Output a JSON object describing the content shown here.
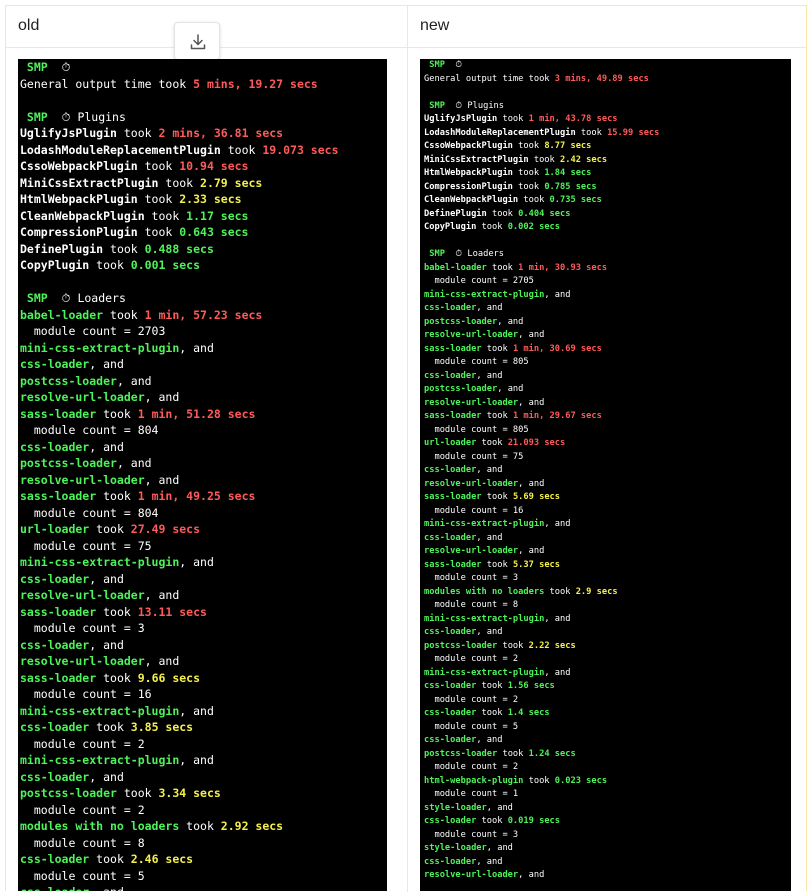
{
  "columns": {
    "old": "old",
    "new": "new"
  },
  "colors": {
    "green": "#4ef25a",
    "red": "#ff5a5a",
    "yellow": "#f5f04a",
    "white": "#ffffff",
    "background": "#000000"
  },
  "icons": {
    "download": "download-icon",
    "stopwatch": "stopwatch-icon"
  },
  "old_log": [
    [
      {
        "t": " SMP  ",
        "c": "smp"
      },
      {
        "t": "⏱",
        "c": "white"
      }
    ],
    [
      {
        "t": "General output time took ",
        "c": "white"
      },
      {
        "t": "5 mins, 19.27 secs",
        "c": "red"
      }
    ],
    [],
    [
      {
        "t": " SMP  ",
        "c": "smp"
      },
      {
        "t": "⏱ Plugins",
        "c": "white"
      }
    ],
    [
      {
        "t": "UglifyJsPlugin",
        "c": "name"
      },
      {
        "t": " took ",
        "c": "white"
      },
      {
        "t": "2 mins, 36.81 secs",
        "c": "red"
      }
    ],
    [
      {
        "t": "LodashModuleReplacementPlugin",
        "c": "name"
      },
      {
        "t": " took ",
        "c": "white"
      },
      {
        "t": "19.073 secs",
        "c": "red"
      }
    ],
    [
      {
        "t": "CssoWebpackPlugin",
        "c": "name"
      },
      {
        "t": " took ",
        "c": "white"
      },
      {
        "t": "10.94 secs",
        "c": "red"
      }
    ],
    [
      {
        "t": "MiniCssExtractPlugin",
        "c": "name"
      },
      {
        "t": " took ",
        "c": "white"
      },
      {
        "t": "2.79 secs",
        "c": "yellow"
      }
    ],
    [
      {
        "t": "HtmlWebpackPlugin",
        "c": "name"
      },
      {
        "t": " took ",
        "c": "white"
      },
      {
        "t": "2.33 secs",
        "c": "yellow"
      }
    ],
    [
      {
        "t": "CleanWebpackPlugin",
        "c": "name"
      },
      {
        "t": " took ",
        "c": "white"
      },
      {
        "t": "1.17 secs",
        "c": "green"
      }
    ],
    [
      {
        "t": "CompressionPlugin",
        "c": "name"
      },
      {
        "t": " took ",
        "c": "white"
      },
      {
        "t": "0.643 secs",
        "c": "green"
      }
    ],
    [
      {
        "t": "DefinePlugin",
        "c": "name"
      },
      {
        "t": " took ",
        "c": "white"
      },
      {
        "t": "0.488 secs",
        "c": "green"
      }
    ],
    [
      {
        "t": "CopyPlugin",
        "c": "name"
      },
      {
        "t": " took ",
        "c": "white"
      },
      {
        "t": "0.001 secs",
        "c": "green"
      }
    ],
    [],
    [
      {
        "t": " SMP  ",
        "c": "smp"
      },
      {
        "t": "⏱ Loaders",
        "c": "white"
      }
    ],
    [
      {
        "t": "babel-loader",
        "c": "green"
      },
      {
        "t": " took ",
        "c": "white"
      },
      {
        "t": "1 min, 57.23 secs",
        "c": "red"
      }
    ],
    [
      {
        "t": "  module count = 2703",
        "c": "white"
      }
    ],
    [
      {
        "t": "mini-css-extract-plugin",
        "c": "green"
      },
      {
        "t": ", and",
        "c": "white"
      }
    ],
    [
      {
        "t": "css-loader",
        "c": "green"
      },
      {
        "t": ", and",
        "c": "white"
      }
    ],
    [
      {
        "t": "postcss-loader",
        "c": "green"
      },
      {
        "t": ", and",
        "c": "white"
      }
    ],
    [
      {
        "t": "resolve-url-loader",
        "c": "green"
      },
      {
        "t": ", and",
        "c": "white"
      }
    ],
    [
      {
        "t": "sass-loader",
        "c": "green"
      },
      {
        "t": " took ",
        "c": "white"
      },
      {
        "t": "1 min, 51.28 secs",
        "c": "red"
      }
    ],
    [
      {
        "t": "  module count = 804",
        "c": "white"
      }
    ],
    [
      {
        "t": "css-loader",
        "c": "green"
      },
      {
        "t": ", and",
        "c": "white"
      }
    ],
    [
      {
        "t": "postcss-loader",
        "c": "green"
      },
      {
        "t": ", and",
        "c": "white"
      }
    ],
    [
      {
        "t": "resolve-url-loader",
        "c": "green"
      },
      {
        "t": ", and",
        "c": "white"
      }
    ],
    [
      {
        "t": "sass-loader",
        "c": "green"
      },
      {
        "t": " took ",
        "c": "white"
      },
      {
        "t": "1 min, 49.25 secs",
        "c": "red"
      }
    ],
    [
      {
        "t": "  module count = 804",
        "c": "white"
      }
    ],
    [
      {
        "t": "url-loader",
        "c": "green"
      },
      {
        "t": " took ",
        "c": "white"
      },
      {
        "t": "27.49 secs",
        "c": "red"
      }
    ],
    [
      {
        "t": "  module count = 75",
        "c": "white"
      }
    ],
    [
      {
        "t": "mini-css-extract-plugin",
        "c": "green"
      },
      {
        "t": ", and",
        "c": "white"
      }
    ],
    [
      {
        "t": "css-loader",
        "c": "green"
      },
      {
        "t": ", and",
        "c": "white"
      }
    ],
    [
      {
        "t": "resolve-url-loader",
        "c": "green"
      },
      {
        "t": ", and",
        "c": "white"
      }
    ],
    [
      {
        "t": "sass-loader",
        "c": "green"
      },
      {
        "t": " took ",
        "c": "white"
      },
      {
        "t": "13.11 secs",
        "c": "red"
      }
    ],
    [
      {
        "t": "  module count = 3",
        "c": "white"
      }
    ],
    [
      {
        "t": "css-loader",
        "c": "green"
      },
      {
        "t": ", and",
        "c": "white"
      }
    ],
    [
      {
        "t": "resolve-url-loader",
        "c": "green"
      },
      {
        "t": ", and",
        "c": "white"
      }
    ],
    [
      {
        "t": "sass-loader",
        "c": "green"
      },
      {
        "t": " took ",
        "c": "white"
      },
      {
        "t": "9.66 secs",
        "c": "yellow"
      }
    ],
    [
      {
        "t": "  module count = 16",
        "c": "white"
      }
    ],
    [
      {
        "t": "mini-css-extract-plugin",
        "c": "green"
      },
      {
        "t": ", and",
        "c": "white"
      }
    ],
    [
      {
        "t": "css-loader",
        "c": "green"
      },
      {
        "t": " took ",
        "c": "white"
      },
      {
        "t": "3.85 secs",
        "c": "yellow"
      }
    ],
    [
      {
        "t": "  module count = 2",
        "c": "white"
      }
    ],
    [
      {
        "t": "mini-css-extract-plugin",
        "c": "green"
      },
      {
        "t": ", and",
        "c": "white"
      }
    ],
    [
      {
        "t": "css-loader",
        "c": "green"
      },
      {
        "t": ", and",
        "c": "white"
      }
    ],
    [
      {
        "t": "postcss-loader",
        "c": "green"
      },
      {
        "t": " took ",
        "c": "white"
      },
      {
        "t": "3.34 secs",
        "c": "yellow"
      }
    ],
    [
      {
        "t": "  module count = 2",
        "c": "white"
      }
    ],
    [
      {
        "t": "modules with no loaders",
        "c": "green"
      },
      {
        "t": " took ",
        "c": "white"
      },
      {
        "t": "2.92 secs",
        "c": "yellow"
      }
    ],
    [
      {
        "t": "  module count = 8",
        "c": "white"
      }
    ],
    [
      {
        "t": "css-loader",
        "c": "green"
      },
      {
        "t": " took ",
        "c": "white"
      },
      {
        "t": "2.46 secs",
        "c": "yellow"
      }
    ],
    [
      {
        "t": "  module count = 5",
        "c": "white"
      }
    ],
    [
      {
        "t": "css-loader",
        "c": "green"
      },
      {
        "t": ", and",
        "c": "white"
      }
    ]
  ],
  "new_log": [
    [
      {
        "t": " SMP  ",
        "c": "smp"
      },
      {
        "t": "⏱",
        "c": "white"
      }
    ],
    [
      {
        "t": "General output time took ",
        "c": "white"
      },
      {
        "t": "3 mins, 49.89 secs",
        "c": "red"
      }
    ],
    [],
    [
      {
        "t": " SMP  ",
        "c": "smp"
      },
      {
        "t": "⏱ Plugins",
        "c": "white"
      }
    ],
    [
      {
        "t": "UglifyJsPlugin",
        "c": "name"
      },
      {
        "t": " took ",
        "c": "white"
      },
      {
        "t": "1 min, 43.78 secs",
        "c": "red"
      }
    ],
    [
      {
        "t": "LodashModuleReplacementPlugin",
        "c": "name"
      },
      {
        "t": " took ",
        "c": "white"
      },
      {
        "t": "15.99 secs",
        "c": "red"
      }
    ],
    [
      {
        "t": "CssoWebpackPlugin",
        "c": "name"
      },
      {
        "t": " took ",
        "c": "white"
      },
      {
        "t": "8.77 secs",
        "c": "yellow"
      }
    ],
    [
      {
        "t": "MiniCssExtractPlugin",
        "c": "name"
      },
      {
        "t": " took ",
        "c": "white"
      },
      {
        "t": "2.42 secs",
        "c": "yellow"
      }
    ],
    [
      {
        "t": "HtmlWebpackPlugin",
        "c": "name"
      },
      {
        "t": " took ",
        "c": "white"
      },
      {
        "t": "1.84 secs",
        "c": "green"
      }
    ],
    [
      {
        "t": "CompressionPlugin",
        "c": "name"
      },
      {
        "t": " took ",
        "c": "white"
      },
      {
        "t": "0.785 secs",
        "c": "green"
      }
    ],
    [
      {
        "t": "CleanWebpackPlugin",
        "c": "name"
      },
      {
        "t": " took ",
        "c": "white"
      },
      {
        "t": "0.735 secs",
        "c": "green"
      }
    ],
    [
      {
        "t": "DefinePlugin",
        "c": "name"
      },
      {
        "t": " took ",
        "c": "white"
      },
      {
        "t": "0.404 secs",
        "c": "green"
      }
    ],
    [
      {
        "t": "CopyPlugin",
        "c": "name"
      },
      {
        "t": " took ",
        "c": "white"
      },
      {
        "t": "0.002 secs",
        "c": "green"
      }
    ],
    [],
    [
      {
        "t": " SMP  ",
        "c": "smp"
      },
      {
        "t": "⏱ Loaders",
        "c": "white"
      }
    ],
    [
      {
        "t": "babel-loader",
        "c": "green"
      },
      {
        "t": " took ",
        "c": "white"
      },
      {
        "t": "1 min, 30.93 secs",
        "c": "red"
      }
    ],
    [
      {
        "t": "  module count = 2705",
        "c": "white"
      }
    ],
    [
      {
        "t": "mini-css-extract-plugin",
        "c": "green"
      },
      {
        "t": ", and",
        "c": "white"
      }
    ],
    [
      {
        "t": "css-loader",
        "c": "green"
      },
      {
        "t": ", and",
        "c": "white"
      }
    ],
    [
      {
        "t": "postcss-loader",
        "c": "green"
      },
      {
        "t": ", and",
        "c": "white"
      }
    ],
    [
      {
        "t": "resolve-url-loader",
        "c": "green"
      },
      {
        "t": ", and",
        "c": "white"
      }
    ],
    [
      {
        "t": "sass-loader",
        "c": "green"
      },
      {
        "t": " took ",
        "c": "white"
      },
      {
        "t": "1 min, 30.69 secs",
        "c": "red"
      }
    ],
    [
      {
        "t": "  module count = 805",
        "c": "white"
      }
    ],
    [
      {
        "t": "css-loader",
        "c": "green"
      },
      {
        "t": ", and",
        "c": "white"
      }
    ],
    [
      {
        "t": "postcss-loader",
        "c": "green"
      },
      {
        "t": ", and",
        "c": "white"
      }
    ],
    [
      {
        "t": "resolve-url-loader",
        "c": "green"
      },
      {
        "t": ", and",
        "c": "white"
      }
    ],
    [
      {
        "t": "sass-loader",
        "c": "green"
      },
      {
        "t": " took ",
        "c": "white"
      },
      {
        "t": "1 min, 29.67 secs",
        "c": "red"
      }
    ],
    [
      {
        "t": "  module count = 805",
        "c": "white"
      }
    ],
    [
      {
        "t": "url-loader",
        "c": "green"
      },
      {
        "t": " took ",
        "c": "white"
      },
      {
        "t": "21.093 secs",
        "c": "red"
      }
    ],
    [
      {
        "t": "  module count = 75",
        "c": "white"
      }
    ],
    [
      {
        "t": "css-loader",
        "c": "green"
      },
      {
        "t": ", and",
        "c": "white"
      }
    ],
    [
      {
        "t": "resolve-url-loader",
        "c": "green"
      },
      {
        "t": ", and",
        "c": "white"
      }
    ],
    [
      {
        "t": "sass-loader",
        "c": "green"
      },
      {
        "t": " took ",
        "c": "white"
      },
      {
        "t": "5.69 secs",
        "c": "yellow"
      }
    ],
    [
      {
        "t": "  module count = 16",
        "c": "white"
      }
    ],
    [
      {
        "t": "mini-css-extract-plugin",
        "c": "green"
      },
      {
        "t": ", and",
        "c": "white"
      }
    ],
    [
      {
        "t": "css-loader",
        "c": "green"
      },
      {
        "t": ", and",
        "c": "white"
      }
    ],
    [
      {
        "t": "resolve-url-loader",
        "c": "green"
      },
      {
        "t": ", and",
        "c": "white"
      }
    ],
    [
      {
        "t": "sass-loader",
        "c": "green"
      },
      {
        "t": " took ",
        "c": "white"
      },
      {
        "t": "5.37 secs",
        "c": "yellow"
      }
    ],
    [
      {
        "t": "  module count = 3",
        "c": "white"
      }
    ],
    [
      {
        "t": "modules with no loaders",
        "c": "green"
      },
      {
        "t": " took ",
        "c": "white"
      },
      {
        "t": "2.9 secs",
        "c": "yellow"
      }
    ],
    [
      {
        "t": "  module count = 8",
        "c": "white"
      }
    ],
    [
      {
        "t": "mini-css-extract-plugin",
        "c": "green"
      },
      {
        "t": ", and",
        "c": "white"
      }
    ],
    [
      {
        "t": "css-loader",
        "c": "green"
      },
      {
        "t": ", and",
        "c": "white"
      }
    ],
    [
      {
        "t": "postcss-loader",
        "c": "green"
      },
      {
        "t": " took ",
        "c": "white"
      },
      {
        "t": "2.22 secs",
        "c": "yellow"
      }
    ],
    [
      {
        "t": "  module count = 2",
        "c": "white"
      }
    ],
    [
      {
        "t": "mini-css-extract-plugin",
        "c": "green"
      },
      {
        "t": ", and",
        "c": "white"
      }
    ],
    [
      {
        "t": "css-loader",
        "c": "green"
      },
      {
        "t": " took ",
        "c": "white"
      },
      {
        "t": "1.56 secs",
        "c": "green"
      }
    ],
    [
      {
        "t": "  module count = 2",
        "c": "white"
      }
    ],
    [
      {
        "t": "css-loader",
        "c": "green"
      },
      {
        "t": " took ",
        "c": "white"
      },
      {
        "t": "1.4 secs",
        "c": "green"
      }
    ],
    [
      {
        "t": "  module count = 5",
        "c": "white"
      }
    ],
    [
      {
        "t": "css-loader",
        "c": "green"
      },
      {
        "t": ", and",
        "c": "white"
      }
    ],
    [
      {
        "t": "postcss-loader",
        "c": "green"
      },
      {
        "t": " took ",
        "c": "white"
      },
      {
        "t": "1.24 secs",
        "c": "green"
      }
    ],
    [
      {
        "t": "  module count = 2",
        "c": "white"
      }
    ],
    [
      {
        "t": "html-webpack-plugin",
        "c": "green"
      },
      {
        "t": " took ",
        "c": "white"
      },
      {
        "t": "0.023 secs",
        "c": "green"
      }
    ],
    [
      {
        "t": "  module count = 1",
        "c": "white"
      }
    ],
    [
      {
        "t": "style-loader",
        "c": "green"
      },
      {
        "t": ", and",
        "c": "white"
      }
    ],
    [
      {
        "t": "css-loader",
        "c": "green"
      },
      {
        "t": " took ",
        "c": "white"
      },
      {
        "t": "0.019 secs",
        "c": "green"
      }
    ],
    [
      {
        "t": "  module count = 3",
        "c": "white"
      }
    ],
    [
      {
        "t": "style-loader",
        "c": "green"
      },
      {
        "t": ", and",
        "c": "white"
      }
    ],
    [
      {
        "t": "css-loader",
        "c": "green"
      },
      {
        "t": ", and",
        "c": "white"
      }
    ],
    [
      {
        "t": "resolve-url-loader",
        "c": "green"
      },
      {
        "t": ", and",
        "c": "white"
      }
    ]
  ]
}
